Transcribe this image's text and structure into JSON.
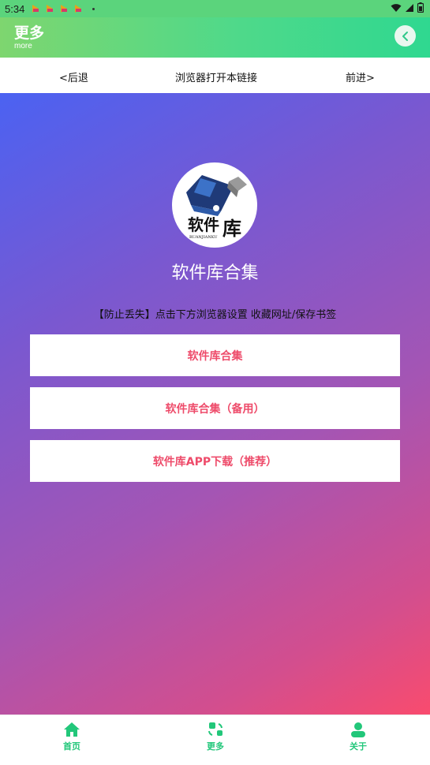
{
  "status_bar": {
    "time": "5:34"
  },
  "header": {
    "title": "更多",
    "subtitle": "more"
  },
  "browser_bar": {
    "back_label": "<后退",
    "open_label": "浏览器打开本链接",
    "forward_label": "前进>"
  },
  "main": {
    "app_title": "软件库合集",
    "notice": "【防止丢失】点击下方浏览器设置 收藏网址/保存书签",
    "logo": {
      "title": "软件库",
      "pinyin": "RUANJIANKU"
    },
    "buttons": [
      {
        "label": "软件库合集"
      },
      {
        "label": "软件库合集（备用）"
      },
      {
        "label": "软件库APP下载（推荐）"
      }
    ]
  },
  "bottom_nav": {
    "tabs": [
      {
        "label": "首页",
        "icon": "home-icon"
      },
      {
        "label": "更多",
        "icon": "more-icon"
      },
      {
        "label": "关于",
        "icon": "user-icon"
      }
    ]
  },
  "colors": {
    "accent_green": "#22c77a",
    "button_text": "#ee4b6a"
  }
}
